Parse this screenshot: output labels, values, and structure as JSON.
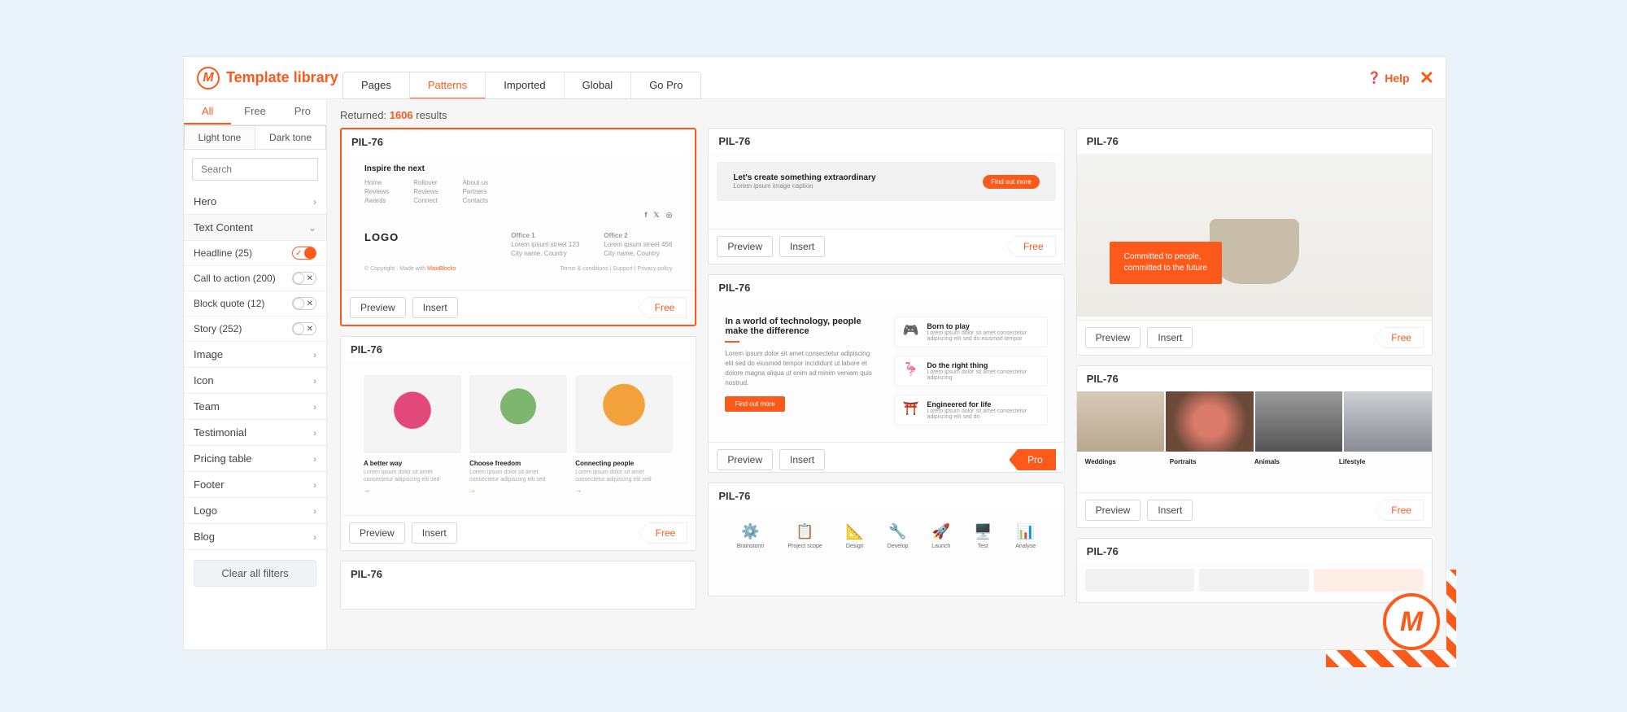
{
  "header": {
    "title": "Template library",
    "tabs": [
      "Pages",
      "Patterns",
      "Imported",
      "Global",
      "Go Pro"
    ],
    "active_tab": "Patterns",
    "help_label": "Help"
  },
  "sidebar": {
    "plan_tabs": [
      "All",
      "Free",
      "Pro"
    ],
    "plan_active": "All",
    "tone_tabs": [
      "Light tone",
      "Dark tone"
    ],
    "tone_active": "Light tone",
    "search_placeholder": "Search",
    "categories": [
      {
        "label": "Hero",
        "expanded": false
      },
      {
        "label": "Text Content",
        "expanded": true,
        "sub": [
          {
            "label": "Headline (25)",
            "on": true
          },
          {
            "label": "Call to action (200)",
            "on": false
          },
          {
            "label": "Block quote (12)",
            "on": false
          },
          {
            "label": "Story (252)",
            "on": false
          }
        ]
      },
      {
        "label": "Image",
        "expanded": false
      },
      {
        "label": "Icon",
        "expanded": false
      },
      {
        "label": "Team",
        "expanded": false
      },
      {
        "label": "Testimonial",
        "expanded": false
      },
      {
        "label": "Pricing table",
        "expanded": false
      },
      {
        "label": "Footer",
        "expanded": false
      },
      {
        "label": "Logo",
        "expanded": false
      },
      {
        "label": "Blog",
        "expanded": false
      }
    ],
    "clear_label": "Clear all filters"
  },
  "results": {
    "prefix": "Returned:",
    "count": "1606",
    "suffix": "results"
  },
  "actions": {
    "preview": "Preview",
    "insert": "Insert",
    "free": "Free",
    "pro": "Pro"
  },
  "col1": {
    "card1": {
      "title": "PIL-76",
      "mock": {
        "headline": "Inspire the next",
        "menu1": [
          "Home",
          "Reviews",
          "Awards"
        ],
        "menu2": [
          "Rollover",
          "Reviews",
          "Connect"
        ],
        "menu3": [
          "About us",
          "Partners",
          "Contacts"
        ],
        "logo": "LOGO",
        "office1_label": "Office 1",
        "office2_label": "Office 2",
        "copyright": "© Copyright · Made with",
        "made_with": "MaxiBlocks",
        "footer_links": "Terms & conditions   |   Support   |   Privacy policy"
      }
    },
    "card2": {
      "title": "PIL-76",
      "caps": [
        "A better way",
        "Choose freedom",
        "Connecting people"
      ]
    },
    "card3": {
      "title": "PIL-76"
    }
  },
  "col2": {
    "card1": {
      "title": "PIL-76",
      "headline": "Let's create something extraordinary",
      "sub": "Lorem ipsum image caption",
      "btn": "Find out more"
    },
    "card2": {
      "title": "PIL-76",
      "headline": "In a world of technology, people make the difference",
      "btn": "Find out more",
      "items": [
        {
          "t": "Born to play"
        },
        {
          "t": "Do the right thing"
        },
        {
          "t": "Engineered for life"
        }
      ]
    },
    "card3": {
      "title": "PIL-76",
      "icons": [
        "Brainstorm",
        "Project scope",
        "Design",
        "Develop",
        "Launch",
        "Test",
        "Analyse"
      ]
    }
  },
  "col3": {
    "card1": {
      "title": "PIL-76",
      "commit1": "Committed to people,",
      "commit2": "committed to the future"
    },
    "card2": {
      "title": "PIL-76",
      "labels": [
        "Weddings",
        "Portraits",
        "Animals",
        "Lifestyle"
      ]
    },
    "card3": {
      "title": "PIL-76"
    }
  }
}
